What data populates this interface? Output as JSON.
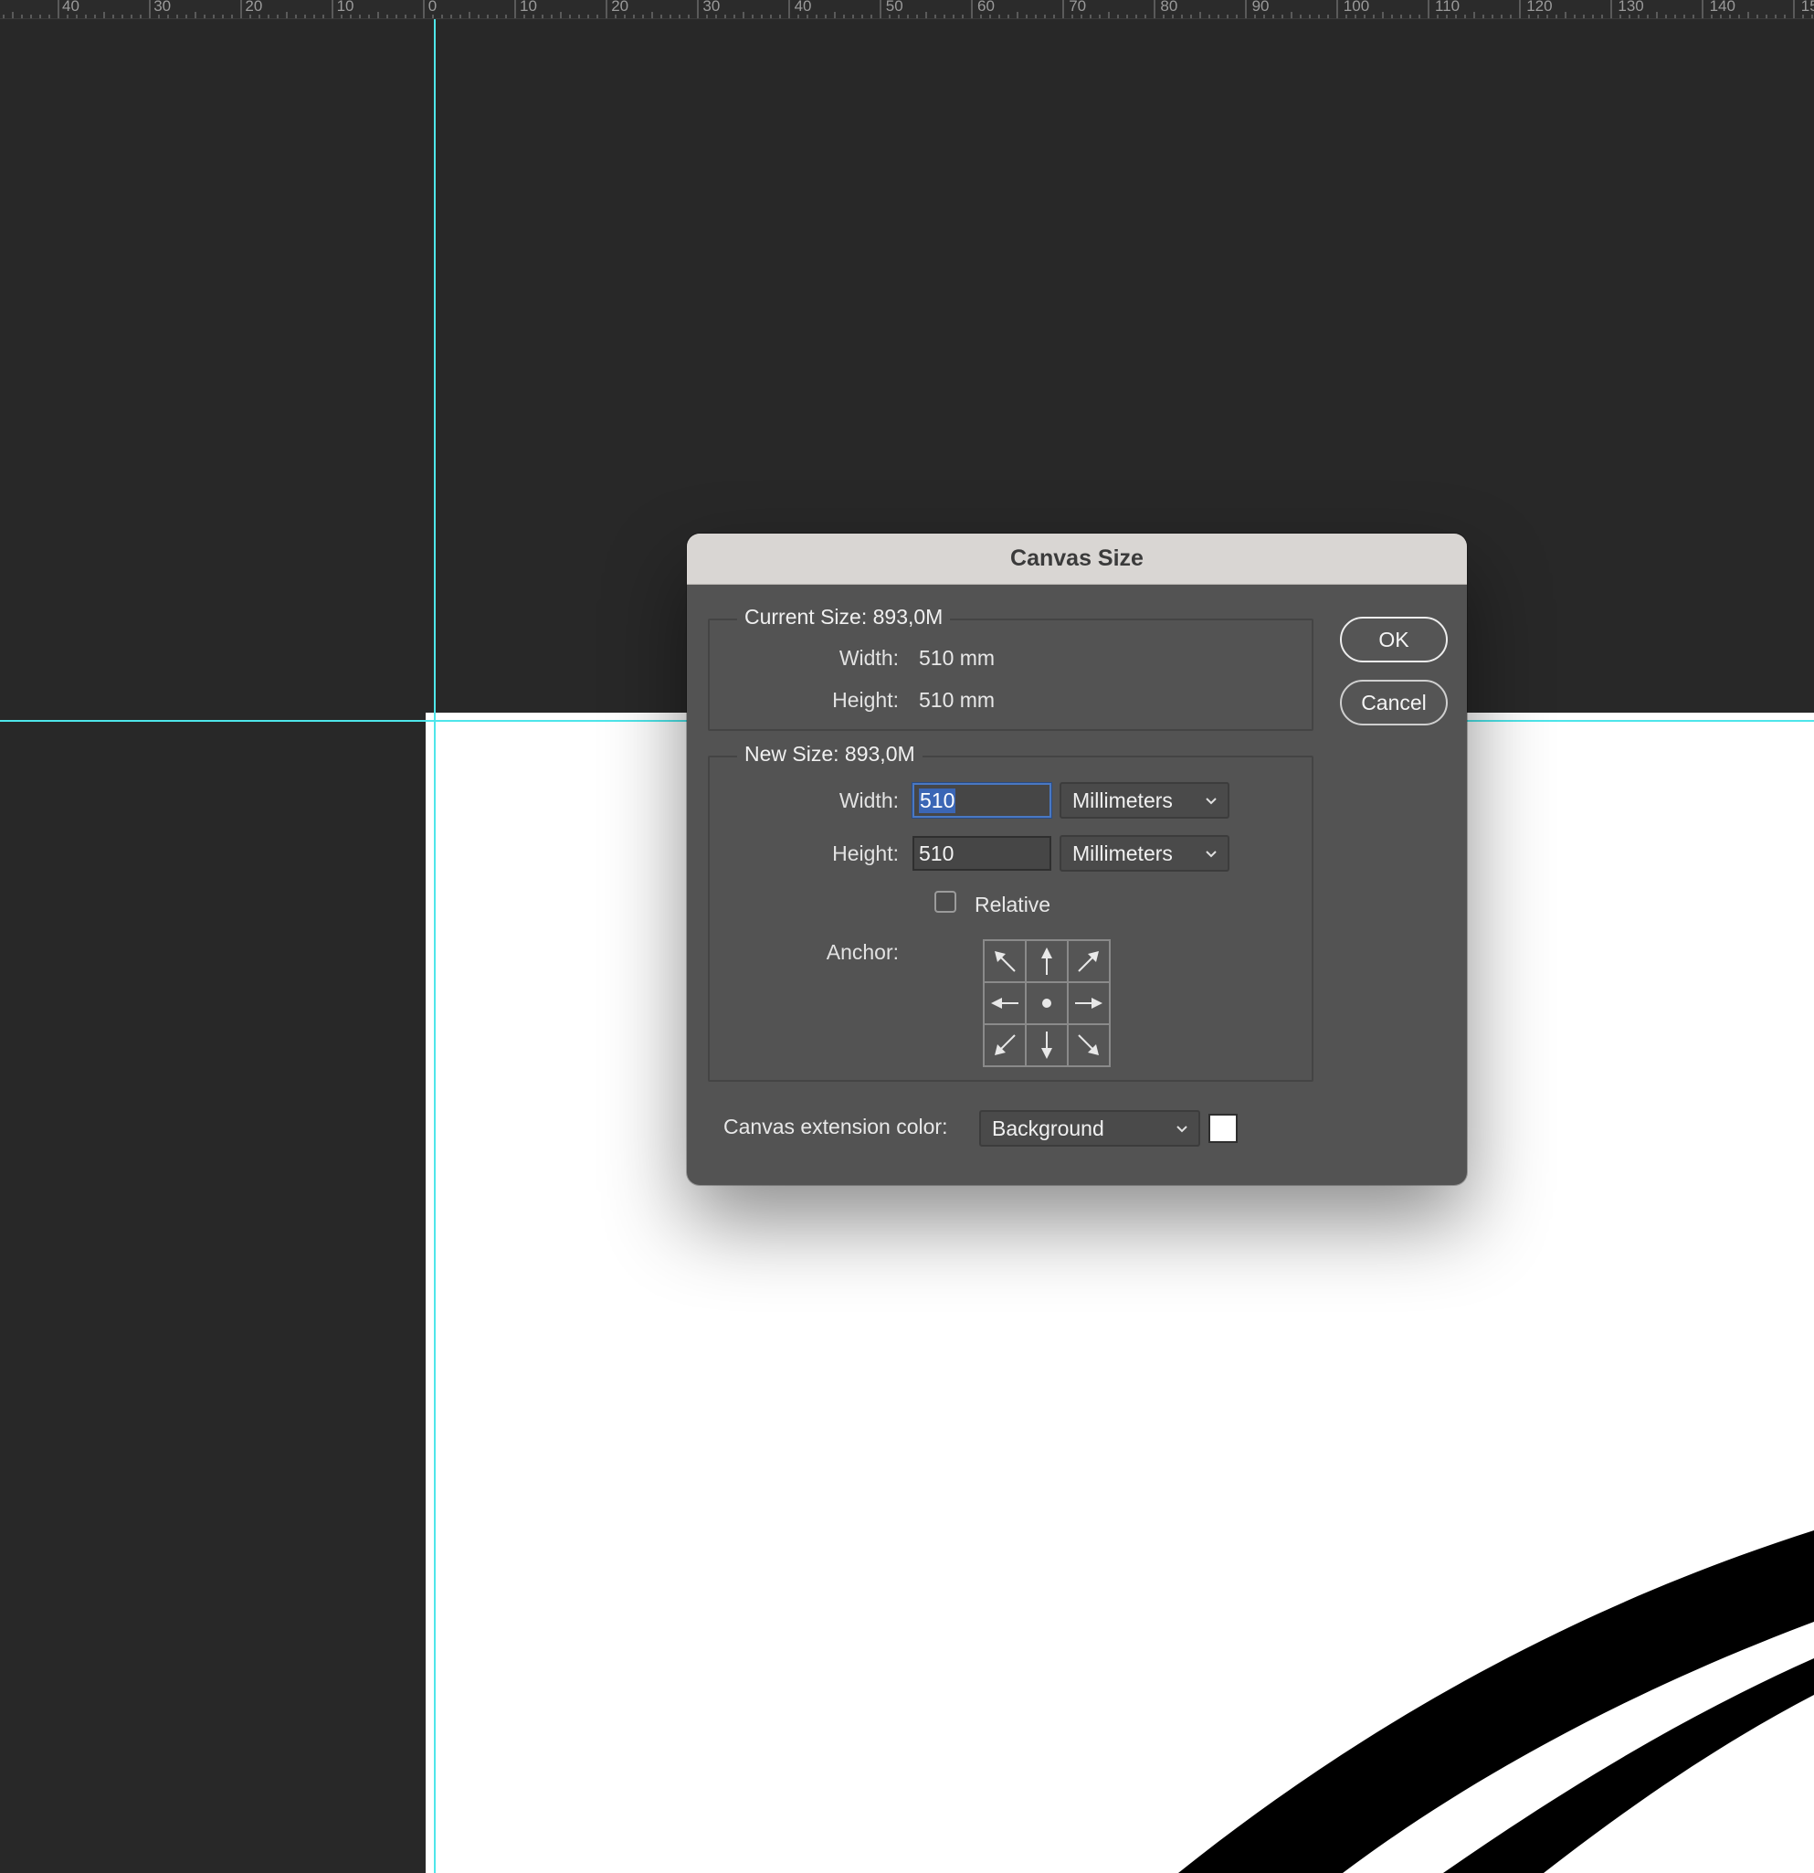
{
  "ruler": {
    "labels": [
      "40",
      "30",
      "20",
      "10",
      "0",
      "10",
      "20",
      "30",
      "40",
      "50",
      "60",
      "70",
      "80",
      "90",
      "100",
      "110",
      "120",
      "130",
      "140",
      "15"
    ]
  },
  "dialog": {
    "title": "Canvas Size",
    "current_size": {
      "legend": "Current Size: 893,0M",
      "width_label": "Width:",
      "width_value": "510 mm",
      "height_label": "Height:",
      "height_value": "510 mm"
    },
    "new_size": {
      "legend": "New Size: 893,0M",
      "width_label": "Width:",
      "width_value": "510",
      "width_unit": "Millimeters",
      "height_label": "Height:",
      "height_value": "510",
      "height_unit": "Millimeters",
      "relative_label": "Relative",
      "relative_checked": false,
      "anchor_label": "Anchor:"
    },
    "extension": {
      "label": "Canvas extension color:",
      "value": "Background",
      "swatch_color": "#ffffff"
    },
    "ok_label": "OK",
    "cancel_label": "Cancel"
  },
  "colors": {
    "workspace": "#282828",
    "guide": "#4ee6ea",
    "dialog_bg": "#535353",
    "selection": "#3b66b5"
  }
}
